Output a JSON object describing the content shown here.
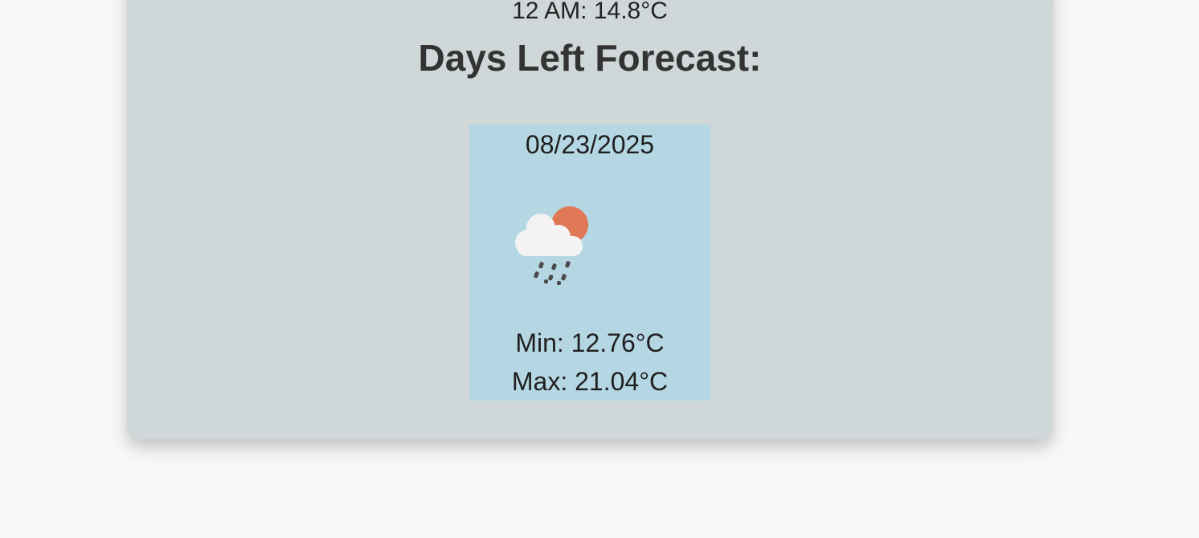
{
  "hourly": {
    "last_entry": "12 AM: 14.8°C"
  },
  "forecast": {
    "title": "Days Left Forecast:",
    "days": [
      {
        "date": "08/23/2025",
        "icon": "cloud-sun-rain-icon",
        "min": "Min: 12.76°C",
        "max": "Max: 21.04°C"
      }
    ]
  },
  "colors": {
    "page_bg": "#f8f8f8",
    "card_bg": "#cfd7d9",
    "day_card_bg": "#b5d7e3",
    "sun": "#e07756"
  }
}
